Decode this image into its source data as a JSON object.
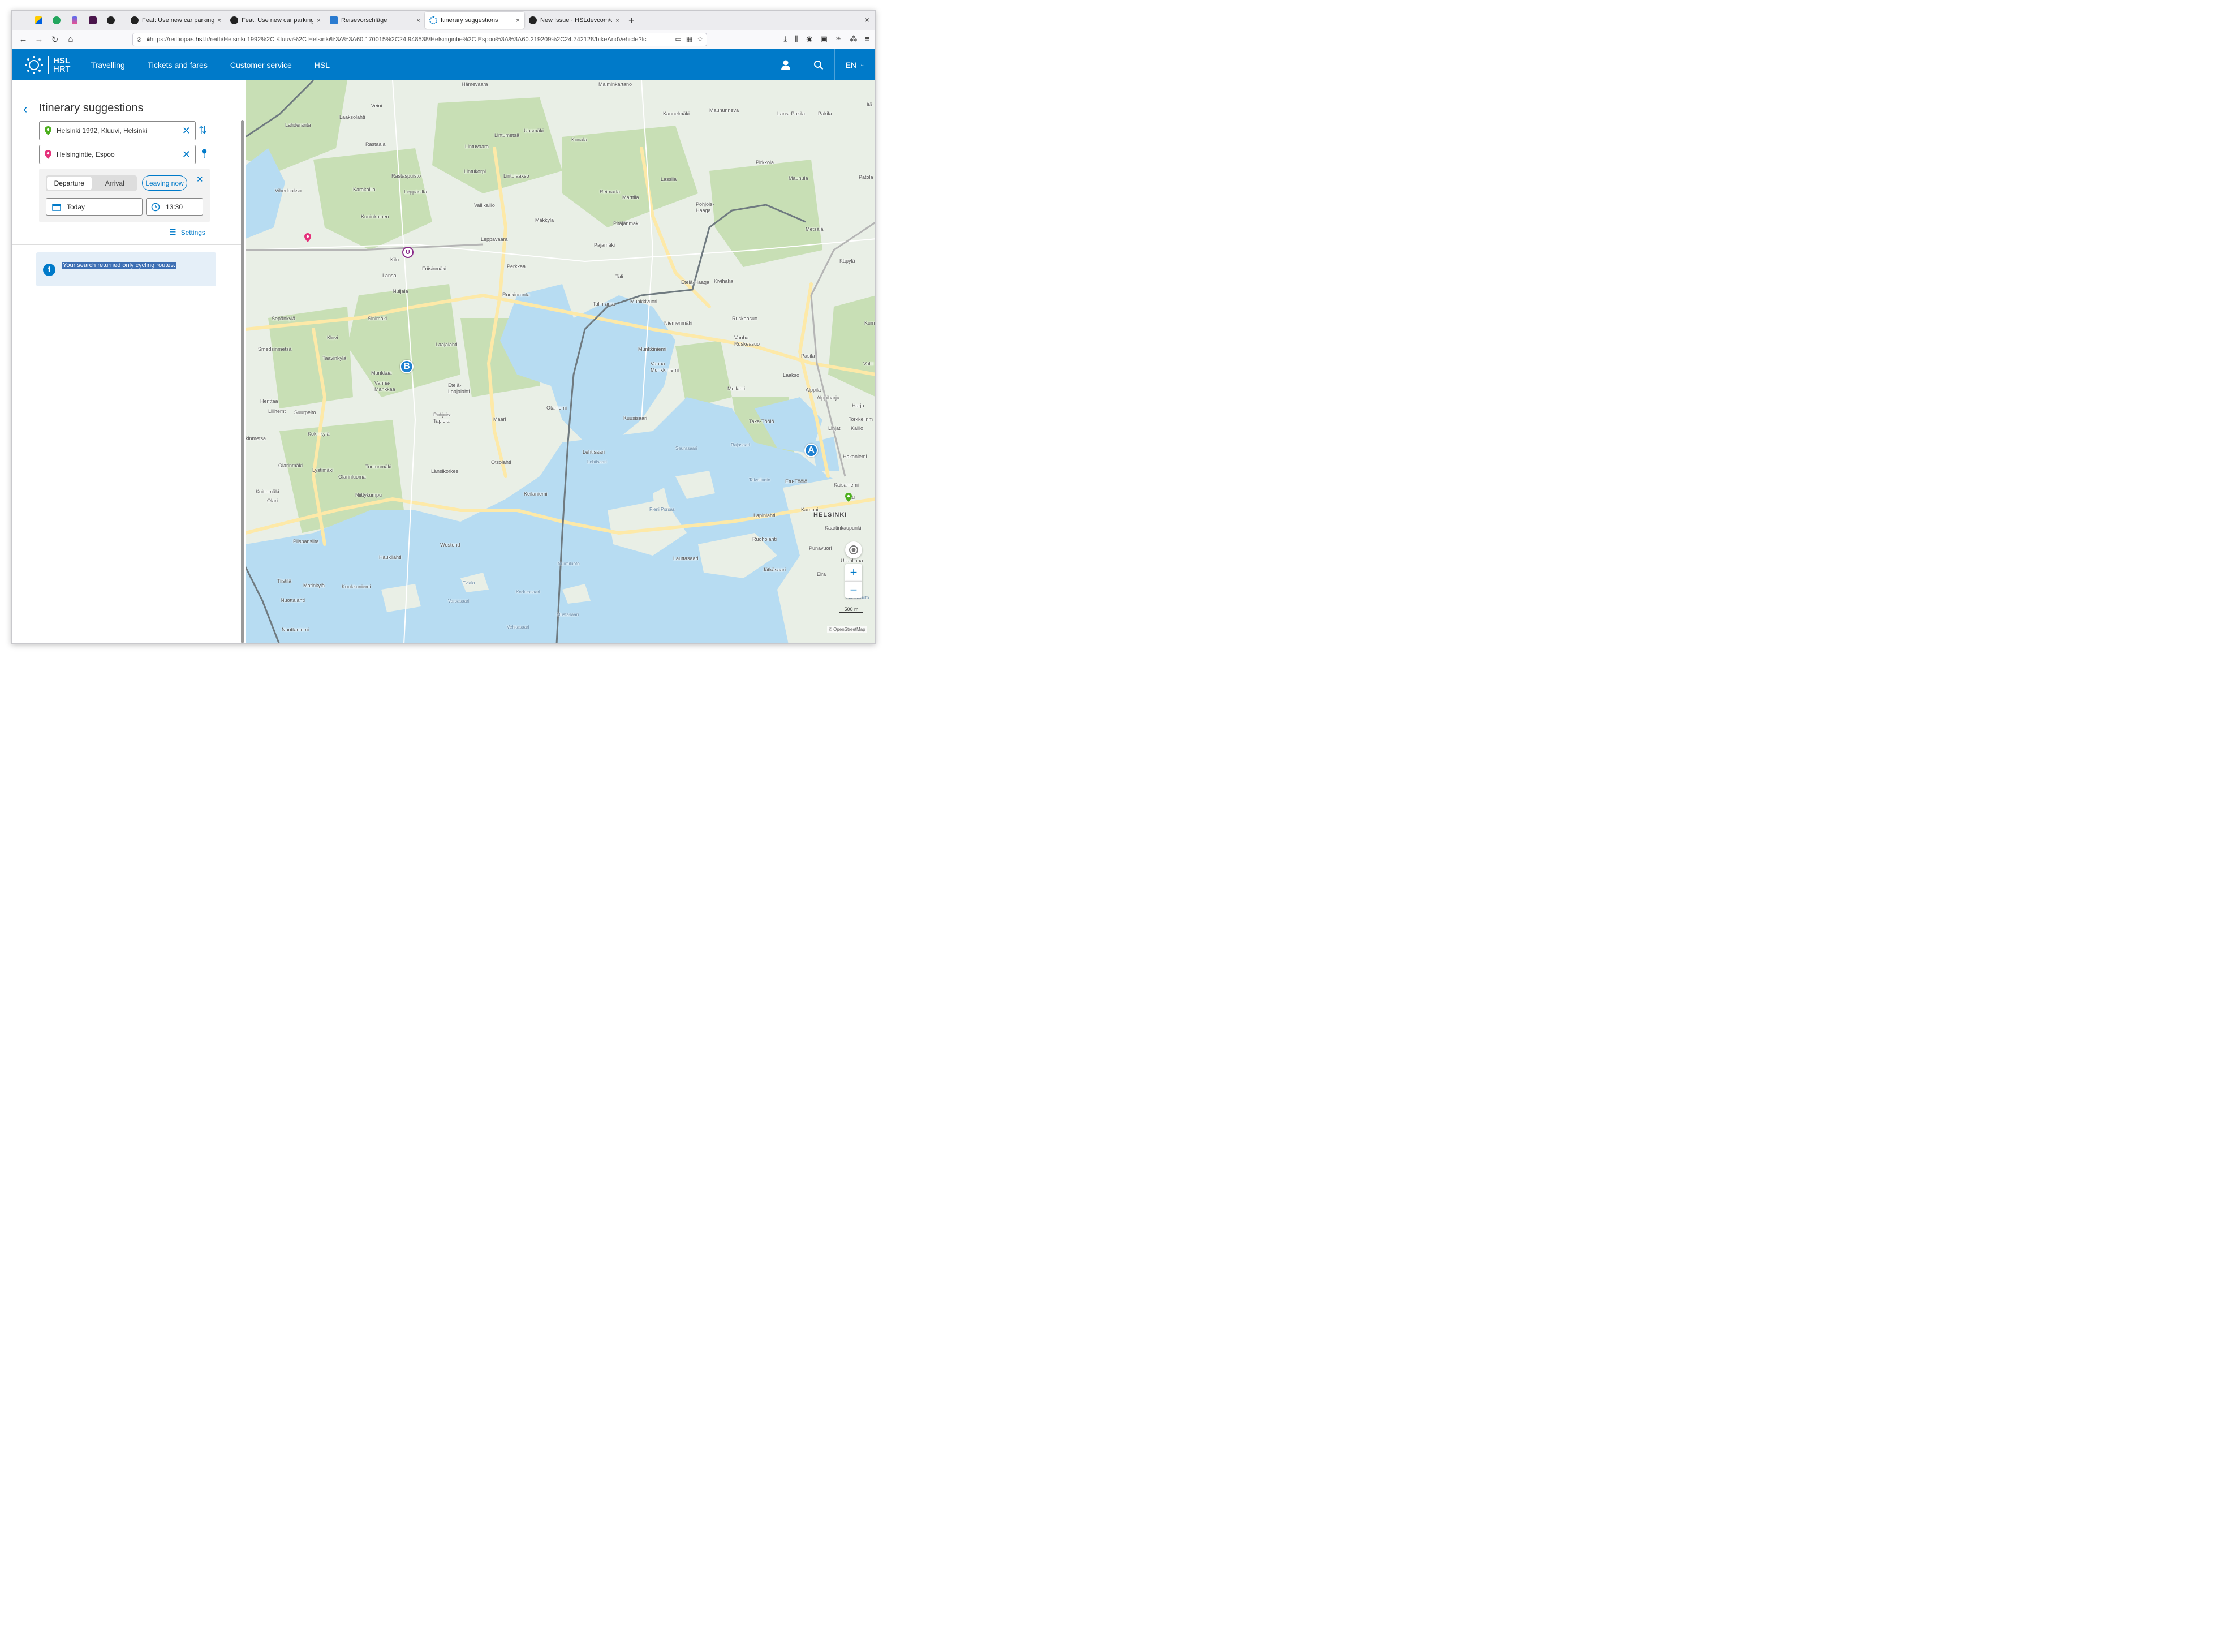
{
  "browser": {
    "tabs": [
      {
        "title": "Feat: Use new car parking lo",
        "close": "×"
      },
      {
        "title": "Feat: Use new car parking lo",
        "close": "×"
      },
      {
        "title": "Reisevorschläge",
        "close": "×"
      },
      {
        "title": "Itinerary suggestions",
        "close": "×",
        "active": true
      },
      {
        "title": "New Issue · HSLdevcom/digi",
        "close": "×"
      }
    ],
    "new_tab": "+",
    "window_close": "×",
    "url_prefix": "https://reittiopas.",
    "url_domain": "hsl.fi",
    "url_rest": "/reitti/Helsinki 1992%2C Kluuvi%2C Helsinki%3A%3A60.170015%2C24.948538/Helsingintie%2C Espoo%3A%3A60.219209%2C24.742128/bikeAndVehicle?lc"
  },
  "header": {
    "logo_line1": "HSL",
    "logo_line2": "HRT",
    "menu": [
      "Travelling",
      "Tickets and fares",
      "Customer service",
      "HSL"
    ],
    "language": "EN"
  },
  "panel": {
    "title": "Itinerary suggestions",
    "origin": "Helsinki 1992, Kluuvi, Helsinki",
    "destination": "Helsingintie, Espoo",
    "departure_label": "Departure",
    "arrival_label": "Arrival",
    "leaving_now": "Leaving now",
    "date": "Today",
    "time": "13:30",
    "settings": "Settings",
    "info_message": "Your search returned only cycling routes."
  },
  "map": {
    "marker_a": "A",
    "marker_b": "B",
    "scale": "500 m",
    "attribution": "© OpenStreetMap",
    "labels": {
      "hamevaara": "Hämevaara",
      "malminkartano": "Malminkartano",
      "veini": "Veini",
      "lahderanta": "Lahderanta",
      "laaksolahti": "Laaksolahti",
      "kannelmaki": "Kannelmäki",
      "maununeva": "Maununneva",
      "lansipakila": "Länsi-Pakila",
      "pakila": "Pakila",
      "uusmaki": "Uusmäki",
      "lintumetsa": "Lintumetsä",
      "konala": "Konala",
      "rastaala": "Rastaala",
      "lintuvaara": "Lintuvaara",
      "pirkkola": "Pirkkola",
      "lassila": "Lassila",
      "maunula": "Maunula",
      "patola": "Patola",
      "lintukorpi": "Lintukorpi",
      "lintulaakso": "Lintulaakso",
      "rastaspuisto": "Rastaspuisto",
      "karakallio": "Karakallio",
      "leppasilta": "Leppäsilta",
      "viherlaakso": "Viherlaakso",
      "reimarla": "Reimarla",
      "marttila": "Marttila",
      "pohjoishaaga": "Pohjois-\nHaaga",
      "vallikallio": "Vallikallio",
      "kuninkainen": "Kuninkainen",
      "makkyla": "Mäkkylä",
      "pitajanmaki": "Pitäjänmäki",
      "metsala": "Metsälä",
      "leppavaara": "Leppävaara",
      "pajamaki": "Pajamäki",
      "kilo": "Kilo",
      "friisinmaki": "Friisinmäki",
      "perkkaa": "Perkkaa",
      "kapyla": "Käpylä",
      "lansa": "Lansa",
      "tali": "Tali",
      "etelahaaga": "Etelä-Haaga",
      "kivihaka": "Kivihaka",
      "nuijala": "Nuijala",
      "ruukinranta": "Ruukinranta",
      "talinranta": "Talinranta",
      "munkkivuori": "Munkkivuori",
      "sepankyla": "Sepänkylä",
      "sinimaki": "Sinimäki",
      "niemenmaki": "Niemenmäki",
      "ruskeasuo": "Ruskeasuo",
      "klovi": "Klovi",
      "laajalahti": "Laajalahti",
      "vanharuskeasuo": "Vanha\nRuskeasuo",
      "smedsinmetsa": "Smedsinmetsä",
      "munkkiniemi": "Munkkiniemi",
      "taavinkyla": "Taavinkylä",
      "pasila": "Pasila",
      "vanhamunkkiniemi": "Vanha\nMunkkiniemi",
      "mankkaa": "Mankkaa",
      "laakso": "Laakso",
      "vanhamankkaa": "Vanha-\nMankkaa",
      "etelalaajalahti": "Etelä-\nLaajalahti",
      "meilahti": "Meilahti",
      "alppila": "Alppila",
      "alppiharju": "Alppiharju",
      "henttaa": "Henttaa",
      "otaniemi": "Otaniemi",
      "harju": "Harju",
      "lillhemt": "Lillhemt",
      "suurpelto": "Suurpelto",
      "pohjoistapiola": "Pohjois-\nTapiola",
      "maari": "Maari",
      "kuusisaari": "Kuusisaari",
      "takatoolo": "Taka-Töölö",
      "torkkelinmaki": "Torkkelinm",
      "linjat": "Linjat",
      "kallio": "Kallio",
      "kokinkyla": "Kokinkylä",
      "kinmetsa": "kinmetsä",
      "rajasaari": "Rajasaari",
      "seurasaari": "Seurasaari",
      "lehtisaari": "Lehtisaari",
      "hakaniemi": "Hakaniemi",
      "olarinmaki": "Olarinmäki",
      "lystimaki": "Lystimäki",
      "tontunmaki": "Tontunmäki",
      "lansikorkee": "Länsikorkee",
      "otsolahti": "Otsolahti",
      "olarinluoma": "Olarinluoma",
      "tahvalluoto": "Taivalluoto",
      "etutoolo": "Etu-Töölö",
      "kaisaniemi": "Kaisaniemi",
      "kuitinmaki": "Kuitinmäki",
      "olari": "Olari",
      "niittykumpu": "Niittykumpu",
      "keilaniemi": "Keilaniemi",
      "kluuvi": "Klu",
      "kamppi": "Kamppi",
      "helsinki": "HELSINKI",
      "pieniporsas": "Pieni Porsas",
      "lapinlahti": "Lapinlahti",
      "kaartinkaupunki": "Kaartinkaupunki",
      "piispansilta": "Piispansilta",
      "ruoholahti": "Ruoholahti",
      "westend": "Westend",
      "punavuori": "Punavuori",
      "haukilahti": "Haukilahti",
      "lauttasaari": "Lauttasaari",
      "ullanlinna": "Ullanlinna",
      "nurmiluoto": "Nurmiluoto",
      "jatkasaari": "Jätkäsaari",
      "eira": "Eira",
      "tiistila": "Tiistilä",
      "matinkyla": "Matinkylä",
      "koukkuniemi": "Koukkuniemi",
      "tvialo": "Tvialo",
      "korkeasaari": "Korkeasaari",
      "nuottalahti": "Nuottalahti",
      "varsasaari": "Varsasaari",
      "mustasaari": "Mustasaari",
      "liuskaluoto": "Liuskaluoto",
      "vehkasaari": "Vehkasaari",
      "nuottaniemi": "Nuottaniemi",
      "ita": "Itä-",
      "kump": "Kump",
      "vallila": "Vallil"
    }
  },
  "colors": {
    "brand": "#007ac9",
    "info_bg": "#e5eff8",
    "water": "#b7dcf2",
    "land": "#e9efe6",
    "forest": "#c8dfb5",
    "road": "#fde9a8",
    "border_line": "#6f7a80"
  }
}
